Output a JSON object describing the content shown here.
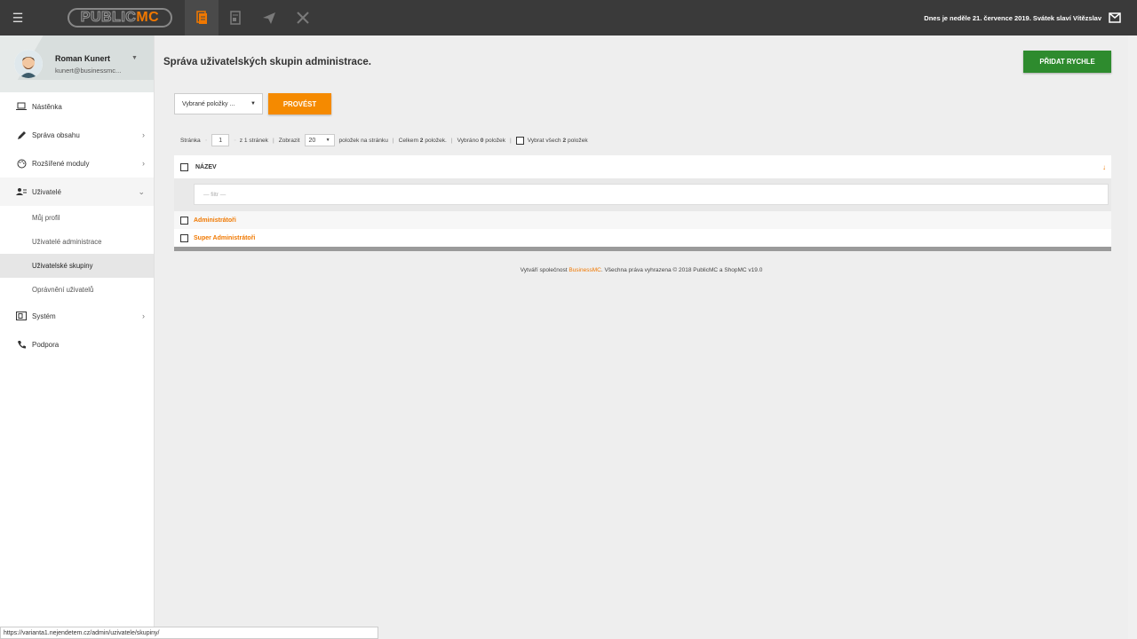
{
  "header": {
    "logo": {
      "prefix": "PUBLIC",
      "suffix": "MC"
    },
    "date_text": "Dnes je neděle 21. července 2019. Svátek slaví Vítězslav",
    "nav_icons": [
      "documents-icon",
      "page-icon",
      "paper-plane-icon",
      "tools-icon"
    ]
  },
  "user": {
    "name": "Roman Kunert",
    "email": "kunert@businessmc..."
  },
  "sidebar": {
    "items": [
      {
        "label": "Nástěnka"
      },
      {
        "label": "Správa obsahu"
      },
      {
        "label": "Rozšířené moduly"
      },
      {
        "label": "Uživatelé"
      },
      {
        "label": "Systém"
      },
      {
        "label": "Podpora"
      }
    ],
    "subitems": [
      {
        "label": "Můj profil"
      },
      {
        "label": "Uživatelé administrace"
      },
      {
        "label": "Uživatelské skupiny"
      },
      {
        "label": "Oprávnění uživatelů"
      }
    ]
  },
  "main": {
    "title": "Správa uživatelských skupin administrace.",
    "add_button": "PŘIDAT RYCHLE",
    "bulk_select": "Vybrané položky ...",
    "run_button": "PROVÉST"
  },
  "pager": {
    "page_label": "Stránka",
    "page_value": "1",
    "of_pages": "z 1 stránek",
    "show_label": "Zobrazit",
    "per_page": "20",
    "per_page_suffix": "položek na stránku",
    "total_prefix": "Celkem",
    "total_count": "2",
    "total_suffix": "položek.",
    "selected_prefix": "Vybráno",
    "selected_count": "0",
    "selected_suffix": "položek",
    "select_all_prefix": "Vybrat všech",
    "select_all_count": "2",
    "select_all_suffix": "položek"
  },
  "table": {
    "column_header": "NÁZEV",
    "filter_placeholder": "— filtr —",
    "rows": [
      {
        "name": "Administrátoři"
      },
      {
        "name": "Super Administrátoři"
      }
    ]
  },
  "footer": {
    "prefix": "Vytváří společnost",
    "brand": "BusinessMC",
    "suffix": ". Všechna práva vyhrazena © 2018 PublicMC a ShopMC v19.0"
  },
  "status_url": "https://varianta1.nejendetem.cz/admin/uzivatele/skupiny/",
  "colors": {
    "accent": "#f07800",
    "green": "#2e8b2e",
    "topbar": "#3a3a3a"
  }
}
